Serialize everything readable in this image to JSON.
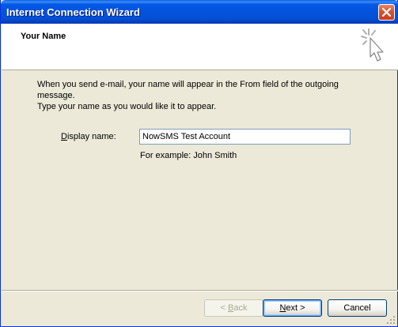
{
  "window": {
    "title": "Internet Connection Wizard",
    "close_icon": "close-icon"
  },
  "header": {
    "title": "Your Name",
    "icon": "wizard-sparkle-cursor-icon"
  },
  "body": {
    "intro_line1": "When you send e-mail, your name will appear in the From field of the outgoing message.",
    "intro_line2": "Type your name as you would like it to appear."
  },
  "form": {
    "display_name_label_key": "D",
    "display_name_label_rest": "isplay name:",
    "display_name_value": "NowSMS Test Account",
    "example_text": "For example: John Smith"
  },
  "buttons": {
    "back_prefix": "< ",
    "back_key": "B",
    "back_rest": "ack",
    "back_enabled": false,
    "next_key": "N",
    "next_rest": "ext >",
    "cancel_label": "Cancel"
  },
  "colors": {
    "titlebar": "#0453dd",
    "dialog_bg": "#ece9d8",
    "header_bg": "#ffffff",
    "input_border": "#7f9db9"
  }
}
